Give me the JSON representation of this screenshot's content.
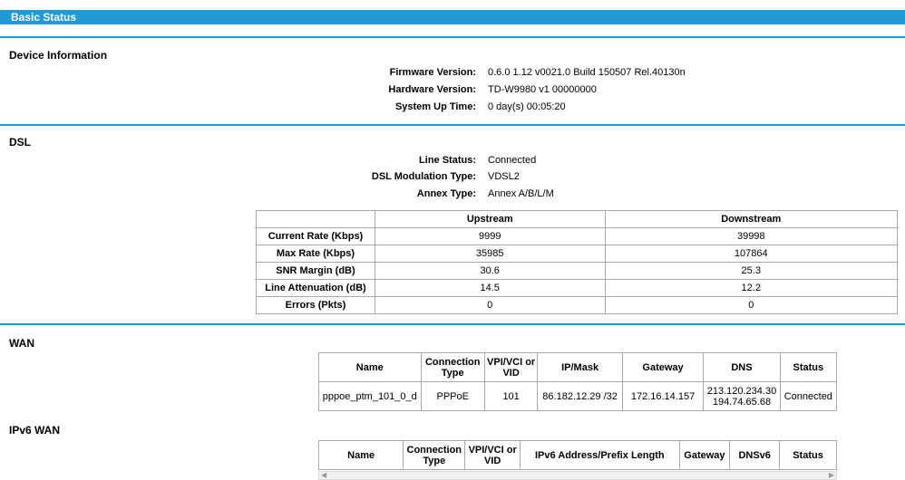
{
  "page": {
    "title": "Basic Status"
  },
  "device_info": {
    "heading": "Device Information",
    "rows": [
      {
        "label": "Firmware Version:",
        "value": "0.6.0 1.12 v0021.0 Build 150507 Rel.40130n"
      },
      {
        "label": "Hardware Version:",
        "value": "TD-W9980 v1 00000000"
      },
      {
        "label": "System Up Time:",
        "value": "0 day(s) 00:05:20"
      }
    ]
  },
  "dsl": {
    "heading": "DSL",
    "rows": [
      {
        "label": "Line Status:",
        "value": "Connected"
      },
      {
        "label": "DSL Modulation Type:",
        "value": "VDSL2"
      },
      {
        "label": "Annex Type:",
        "value": "Annex A/B/L/M"
      }
    ],
    "table": {
      "columns": [
        "",
        "Upstream",
        "Downstream"
      ],
      "rows": [
        {
          "label": "Current Rate (Kbps)",
          "up": "9999",
          "down": "39998"
        },
        {
          "label": "Max Rate (Kbps)",
          "up": "35985",
          "down": "107864"
        },
        {
          "label": "SNR Margin (dB)",
          "up": "30.6",
          "down": "25.3"
        },
        {
          "label": "Line Attenuation (dB)",
          "up": "14.5",
          "down": "12.2"
        },
        {
          "label": "Errors (Pkts)",
          "up": "0",
          "down": "0"
        }
      ]
    }
  },
  "wan": {
    "heading": "WAN",
    "columns": {
      "name": "Name",
      "conn_type_1": "Connection",
      "conn_type_2": "Type",
      "vpi_1": "VPI/VCI or",
      "vpi_2": "VID",
      "ipmask": "IP/Mask",
      "gateway": "Gateway",
      "dns": "DNS",
      "status": "Status"
    },
    "row": {
      "name": "pppoe_ptm_101_0_d",
      "conn_type": "PPPoE",
      "vid": "101",
      "ipmask": "86.182.12.29 /32",
      "gateway": "172.16.14.157",
      "dns_1": "213.120.234.30",
      "dns_2": "194.74.65.68",
      "status": "Connected"
    }
  },
  "ipv6wan": {
    "heading": "IPv6 WAN",
    "columns": {
      "name": "Name",
      "conn_type_1": "Connection",
      "conn_type_2": "Type",
      "vpi_1": "VPI/VCI or",
      "vpi_2": "VID",
      "prefix": "IPv6 Address/Prefix Length",
      "gateway": "Gateway",
      "dns": "DNSv6",
      "status": "Status"
    }
  },
  "icons": {
    "scroll_left": "chevron-left-icon",
    "scroll_right": "chevron-right-icon"
  },
  "colors": {
    "accent": "#1f9ad6"
  }
}
